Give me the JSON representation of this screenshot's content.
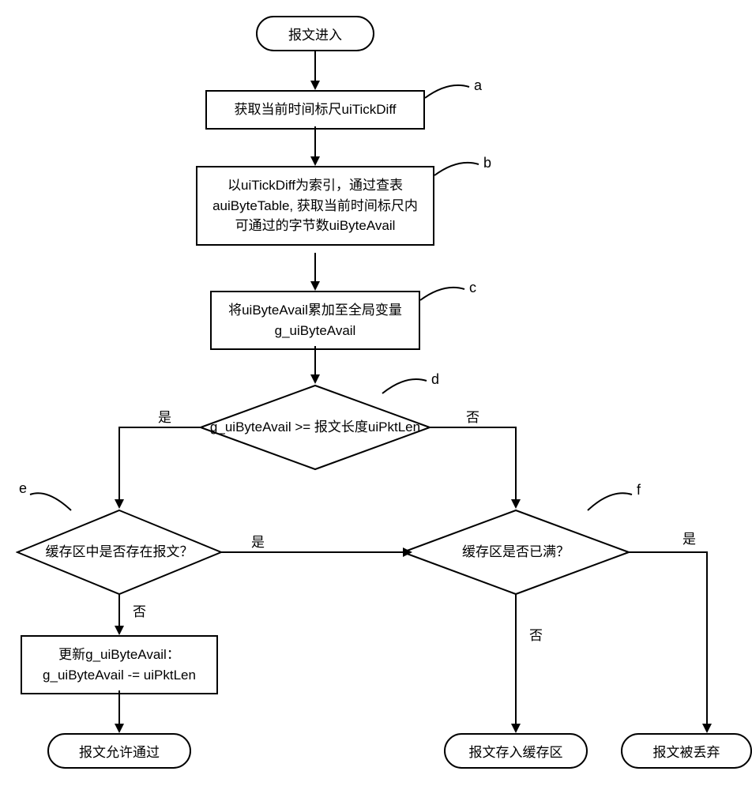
{
  "nodes": {
    "start": "报文进入",
    "a": "获取当前时间标尺uiTickDiff",
    "b": "以uiTickDiff为索引，通过查表auiByteTable, 获取当前时间标尺内可通过的字节数uiByteAvail",
    "c": "将uiByteAvail累加至全局变量g_uiByteAvail",
    "d": "g_uiByteAvail >= 报文长度uiPktLen",
    "e": "缓存区中是否存在报文？",
    "f": "缓存区是否已满？",
    "update": "更新g_uiByteAvail：\ng_uiByteAvail -= uiPktLen",
    "end_pass": "报文允许通过",
    "end_store": "报文存入缓存区",
    "end_drop": "报文被丢弃"
  },
  "labels": {
    "a": "a",
    "b": "b",
    "c": "c",
    "d": "d",
    "e": "e",
    "f": "f"
  },
  "branches": {
    "yes": "是",
    "no": "否"
  }
}
